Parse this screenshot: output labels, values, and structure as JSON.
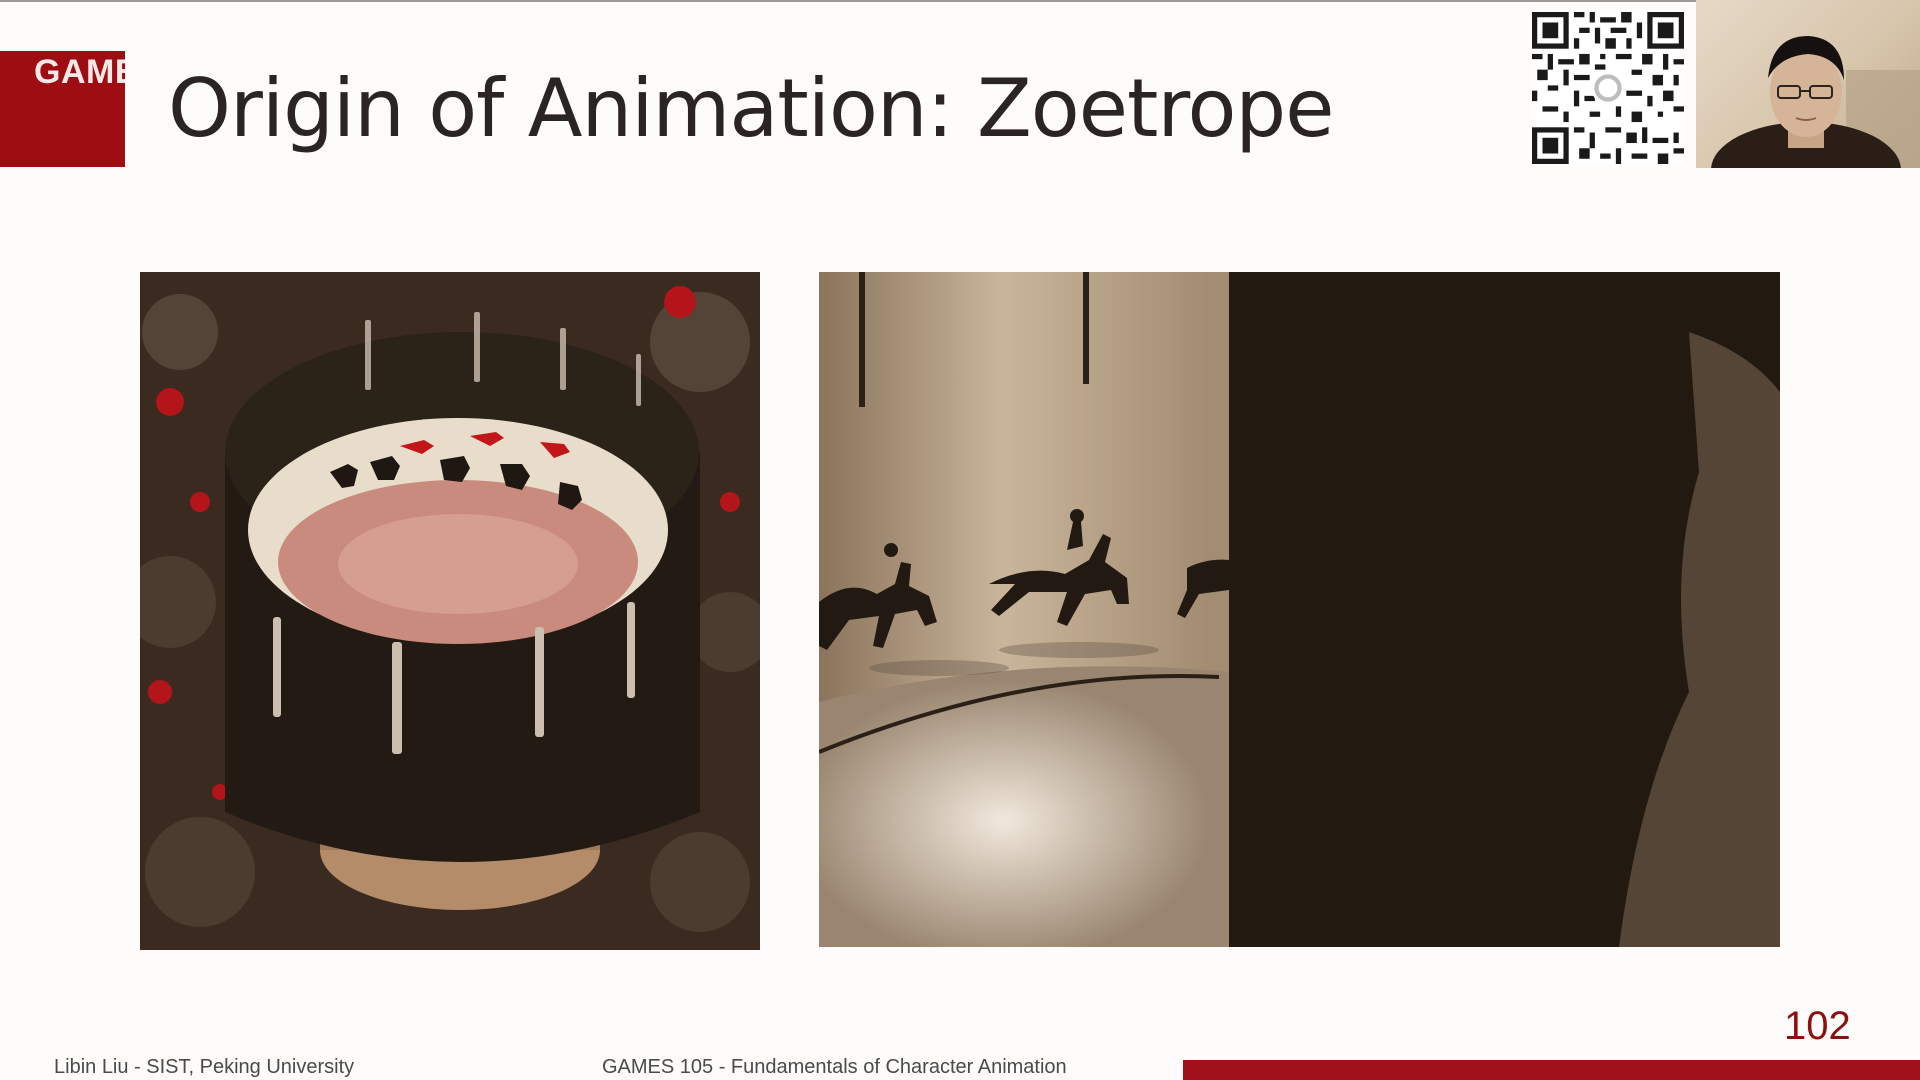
{
  "slide": {
    "title": "Origin of Animation: Zoetrope",
    "logo_text": "GAMES",
    "page_number": "102",
    "footer_left": "Libin Liu - SIST, Peking University",
    "footer_center": "GAMES 105 - Fundamentals of Character Animation"
  },
  "images": {
    "left_photo": "zoetrope-drum-photo",
    "right_photo": "zoetrope-horse-rider-animation-photo",
    "qr_code": "qr-code",
    "webcam": "presenter-webcam"
  },
  "colors": {
    "accent": "#9e0d12",
    "page_number": "#8c1010",
    "background": "#fdfcfa"
  }
}
